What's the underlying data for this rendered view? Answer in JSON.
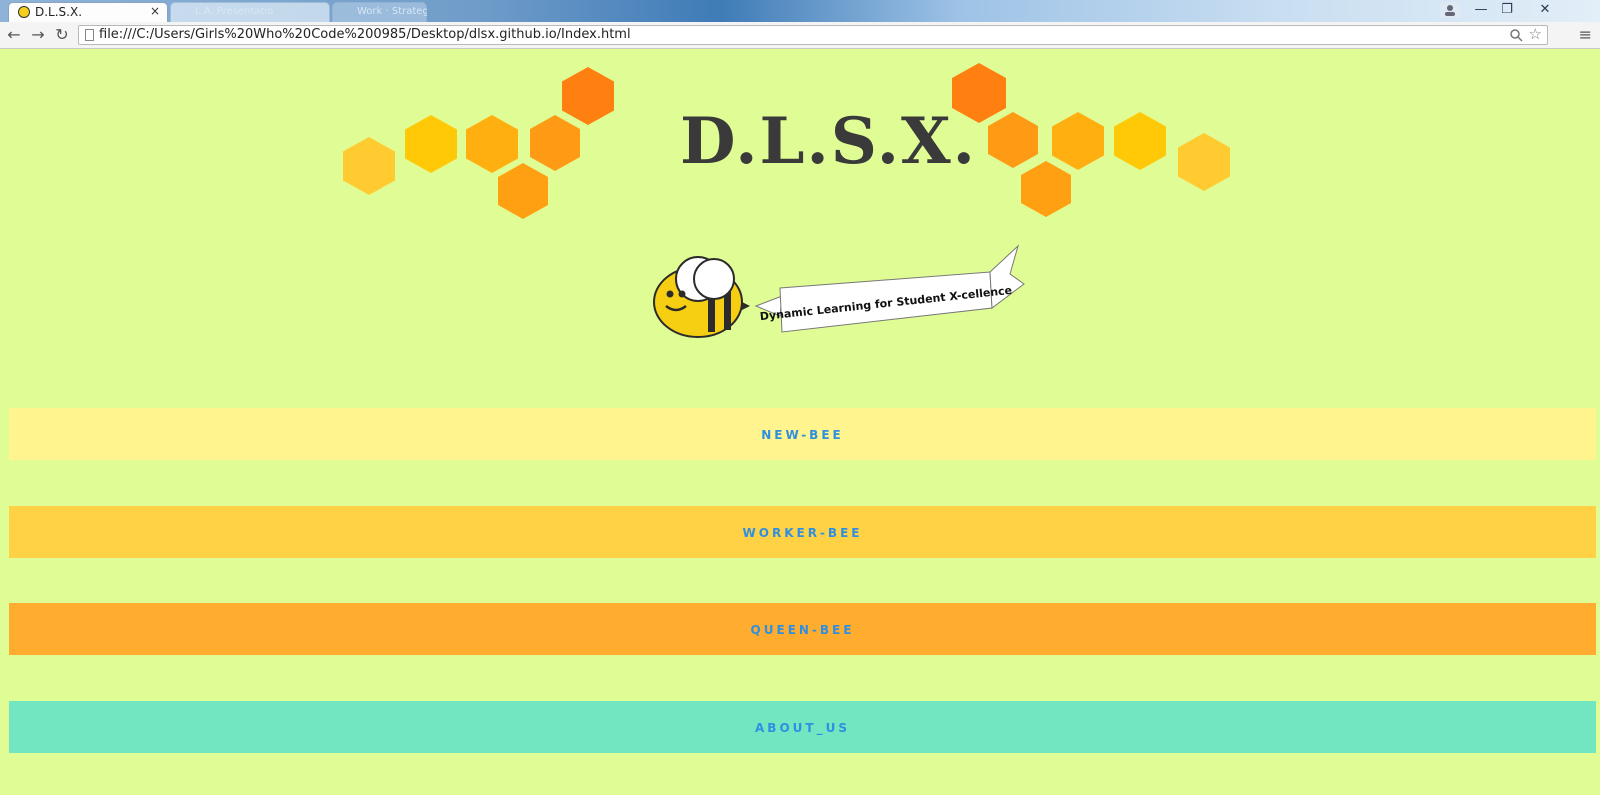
{
  "browser": {
    "active_tab": {
      "title": "D.L.S.X.",
      "close": "×"
    },
    "background_tabs": [
      "L.A. Presentatio",
      "Work · Strateg"
    ],
    "window_controls": {
      "minimize": "—",
      "restore": "❐",
      "close": "✕"
    },
    "url": "file:///C:/Users/Girls%20Who%20Code%200985/Desktop/dlsx.github.io/Index.html"
  },
  "page": {
    "title": "D.L.S.X.",
    "banner_text": "Dynamic Learning for Student X-cellence",
    "nav": [
      {
        "label": "NEW-BEE",
        "color": "#fff48e"
      },
      {
        "label": "WORKER-BEE",
        "color": "#ffd145"
      },
      {
        "label": "QUEEN-BEE",
        "color": "#ffac2f"
      },
      {
        "label": "ABOUT_US",
        "color": "#72e6c0"
      }
    ],
    "colors": {
      "background": "#e0fd95",
      "link_text": "#2f8fe0",
      "hex_orange": "#ff7f10",
      "hex_amber": "#ffa41a",
      "hex_yellow": "#ffcb0a",
      "hex_light": "#ffcc33"
    }
  }
}
